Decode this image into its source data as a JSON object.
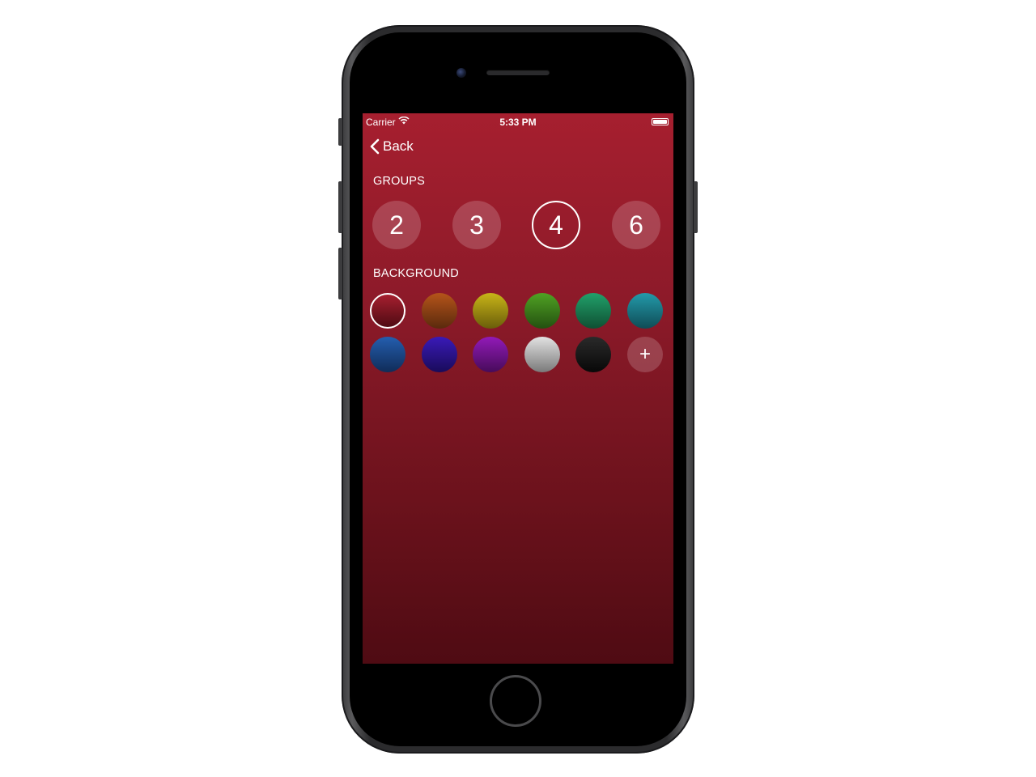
{
  "status_bar": {
    "carrier": "Carrier",
    "time": "5:33 PM",
    "wifi_icon": "wifi-icon",
    "battery_icon": "battery-icon"
  },
  "nav": {
    "back_label": "Back",
    "back_icon": "chevron-left-icon"
  },
  "groups": {
    "label": "GROUPS",
    "options": [
      "2",
      "3",
      "4",
      "6"
    ],
    "selected": "4"
  },
  "background": {
    "label": "BACKGROUND",
    "swatches": [
      {
        "name": "red",
        "top": "#a61f2f",
        "bottom": "#4f0b13",
        "selected": true
      },
      {
        "name": "orange",
        "top": "#b5541a",
        "bottom": "#5a2a0d"
      },
      {
        "name": "yellow",
        "top": "#c8b418",
        "bottom": "#6a5e0a"
      },
      {
        "name": "green",
        "top": "#4fa223",
        "bottom": "#245010"
      },
      {
        "name": "emerald",
        "top": "#21a06a",
        "bottom": "#0f5033"
      },
      {
        "name": "teal",
        "top": "#239aaa",
        "bottom": "#0f4c56"
      },
      {
        "name": "blue",
        "top": "#245eaf",
        "bottom": "#102c58"
      },
      {
        "name": "indigo",
        "top": "#3a1ab8",
        "bottom": "#190b5a"
      },
      {
        "name": "purple",
        "top": "#921ab8",
        "bottom": "#470b5a"
      },
      {
        "name": "silver",
        "top": "#e2e2e2",
        "bottom": "#7a7a7a"
      },
      {
        "name": "black",
        "top": "#2a2a2a",
        "bottom": "#080808"
      }
    ],
    "add_label": "+"
  }
}
